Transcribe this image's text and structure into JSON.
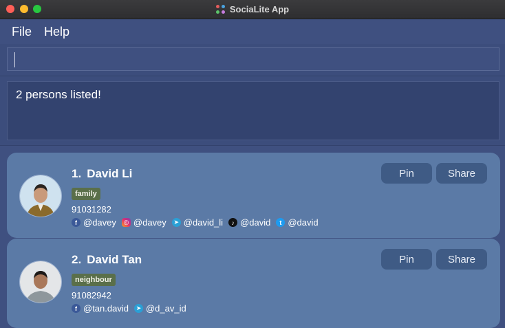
{
  "window": {
    "title": "SociaLite App"
  },
  "menu": [
    "File",
    "Help"
  ],
  "command": {
    "value": ""
  },
  "result": {
    "message": "2 persons listed!"
  },
  "persons": [
    {
      "index": "1.",
      "name": "David Li",
      "tag": "family",
      "phone": "91031282",
      "socials": [
        {
          "icon": "facebook-icon",
          "handle": "@davey"
        },
        {
          "icon": "instagram-icon",
          "handle": "@davey"
        },
        {
          "icon": "telegram-icon",
          "handle": "@david_li"
        },
        {
          "icon": "tiktok-icon",
          "handle": "@david"
        },
        {
          "icon": "twitter-icon",
          "handle": "@david"
        }
      ],
      "buttons": {
        "pin": "Pin",
        "share": "Share"
      }
    },
    {
      "index": "2.",
      "name": "David Tan",
      "tag": "neighbour",
      "phone": "91082942",
      "socials": [
        {
          "icon": "facebook-icon",
          "handle": "@tan.david"
        },
        {
          "icon": "telegram-icon",
          "handle": "@d_av_id"
        }
      ],
      "buttons": {
        "pin": "Pin",
        "share": "Share"
      }
    }
  ],
  "colors": {
    "background": "#3f5080",
    "card": "#5b7aa6",
    "button": "#3f5b85",
    "tag": "#5a6f4a"
  }
}
